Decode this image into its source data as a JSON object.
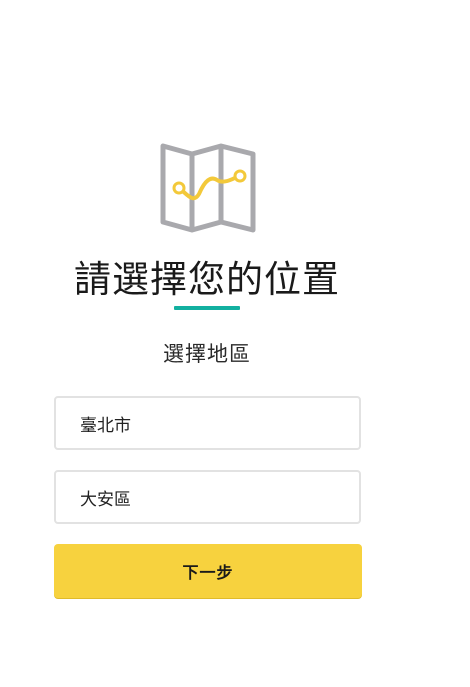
{
  "header": {
    "icon": "folded-map-route-icon",
    "title": "請選擇您的位置",
    "subtitle": "選擇地區"
  },
  "form": {
    "city_value": "臺北市",
    "district_value": "大安區",
    "next_label": "下一步"
  },
  "colors": {
    "accent_underline": "#12b0a0",
    "button": "#f7d23e",
    "route": "#f3c93a",
    "map_outline": "#a9a9ad"
  }
}
